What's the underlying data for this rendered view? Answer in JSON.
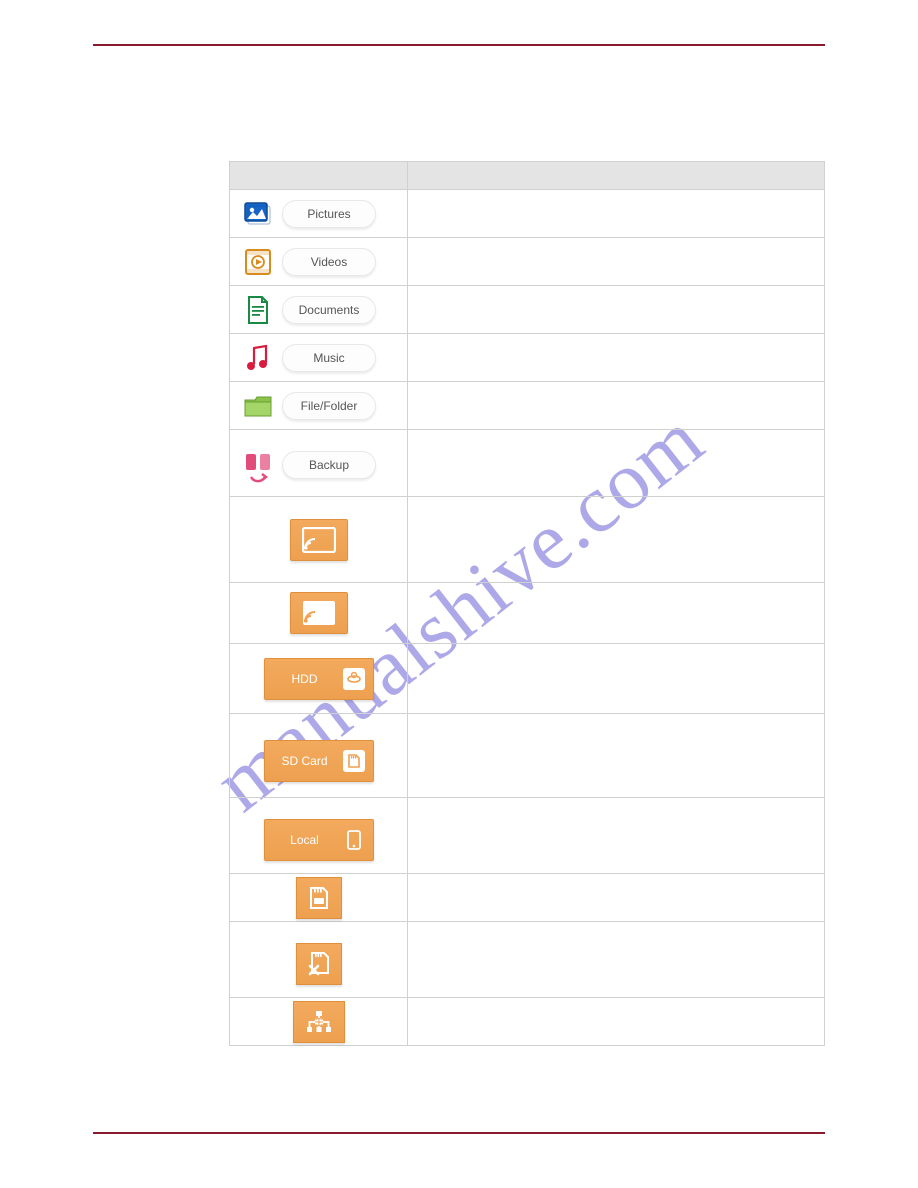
{
  "watermark": "manualshive.com",
  "categories": {
    "pictures": {
      "label": "Pictures"
    },
    "videos": {
      "label": "Videos"
    },
    "documents": {
      "label": "Documents"
    },
    "music": {
      "label": "Music"
    },
    "filefolder": {
      "label": "File/Folder"
    },
    "backup": {
      "label": "Backup"
    }
  },
  "storage": {
    "hdd": {
      "label": "HDD"
    },
    "sdcard": {
      "label": "SD Card"
    },
    "local": {
      "label": "Local"
    }
  }
}
